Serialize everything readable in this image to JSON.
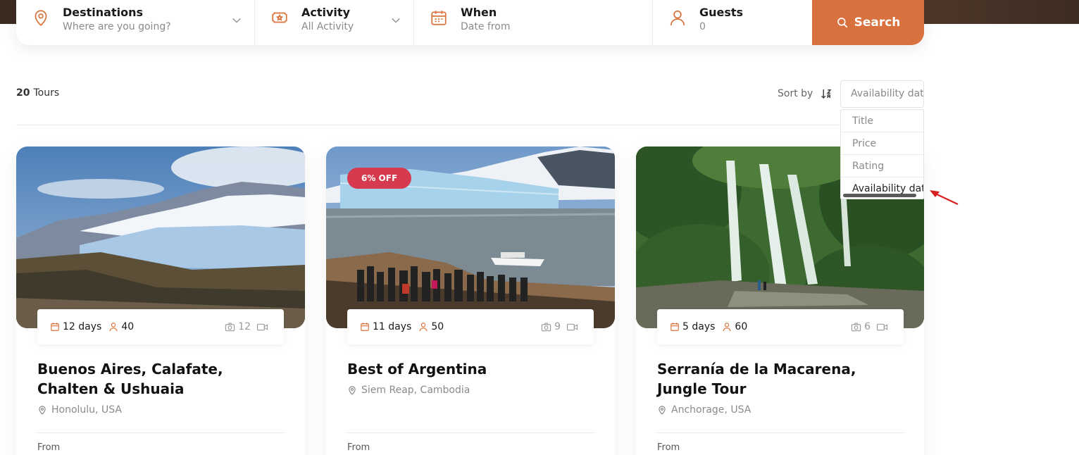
{
  "search": {
    "destinations": {
      "label": "Destinations",
      "value": "Where are you going?"
    },
    "activity": {
      "label": "Activity",
      "value": "All Activity"
    },
    "when": {
      "label": "When",
      "value": "Date from"
    },
    "guests": {
      "label": "Guests",
      "value": "0"
    },
    "button": "Search"
  },
  "results": {
    "count": "20",
    "noun": "Tours"
  },
  "sort": {
    "label": "Sort by",
    "selected": "Availability date",
    "options": [
      "Title",
      "Price",
      "Rating",
      "Availability date"
    ]
  },
  "colors": {
    "accent": "#d8713d",
    "badge": "#d63a4f"
  },
  "cards": [
    {
      "days": "12 days",
      "guests": "40",
      "photos": "12",
      "title": "Buenos Aires, Calafate, Chalten & Ushuaia",
      "location": "Honolulu, USA",
      "from": "From"
    },
    {
      "badge": "6% OFF",
      "days": "11 days",
      "guests": "50",
      "photos": "9",
      "title": "Best of Argentina",
      "location": "Siem Reap, Cambodia",
      "from": "From"
    },
    {
      "days": "5 days",
      "guests": "60",
      "photos": "6",
      "title": "Serranía de la Macarena, Jungle Tour",
      "location": "Anchorage, USA",
      "from": "From"
    }
  ]
}
